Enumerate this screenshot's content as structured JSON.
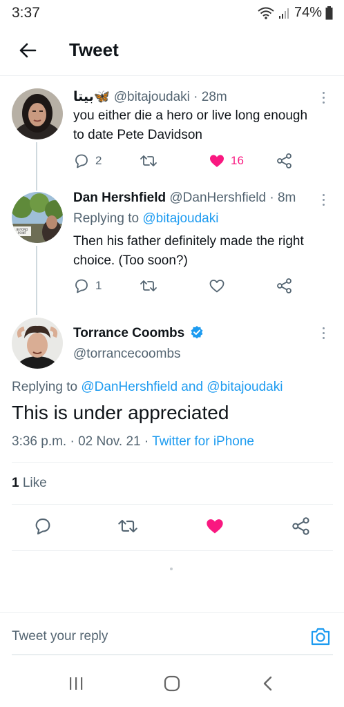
{
  "status_bar": {
    "time": "3:37",
    "battery": "74%"
  },
  "header": {
    "title": "Tweet"
  },
  "tweets": [
    {
      "display_name": "بيتا🦋",
      "handle": "@bitajoudaki",
      "time": "28m",
      "text_lines": [
        "you either die a hero or live long enough",
        "to date Pete Davidson"
      ],
      "replies": "2",
      "likes": "16",
      "liked": true
    },
    {
      "display_name": "Dan Hershfield",
      "handle": "@DanHershfield",
      "time": "8m",
      "replying_prefix": "Replying to ",
      "replying_handle": "@bitajoudaki",
      "text_lines": [
        "Then his father definitely made the right",
        "choice. (Too soon?)"
      ],
      "replies": "1",
      "avatar_sign": "BEYOND\nPOINT"
    }
  ],
  "main_tweet": {
    "display_name": "Torrance Coombs",
    "handle": "@torrancecoombs",
    "replying_prefix": "Replying to ",
    "replying_handle_1": "@DanHershfield",
    "replying_and": " and ",
    "replying_handle_2": "@bitajoudaki",
    "text": "This is under appreciated",
    "time": "3:36 p.m.",
    "separator": " · ",
    "date": "02 Nov. 21",
    "source": "Twitter for iPhone",
    "like_count": "1",
    "like_label": " Like"
  },
  "reply_bar": {
    "placeholder": "Tweet your reply"
  },
  "colors": {
    "accent": "#1d9bf0",
    "like": "#f91880",
    "muted": "#536471"
  },
  "icons": [
    "back-arrow-icon",
    "more-icon",
    "reply-icon",
    "retweet-icon",
    "heart-icon",
    "share-icon",
    "verified-icon",
    "camera-icon",
    "recents-icon",
    "home-icon",
    "back-nav-icon"
  ]
}
